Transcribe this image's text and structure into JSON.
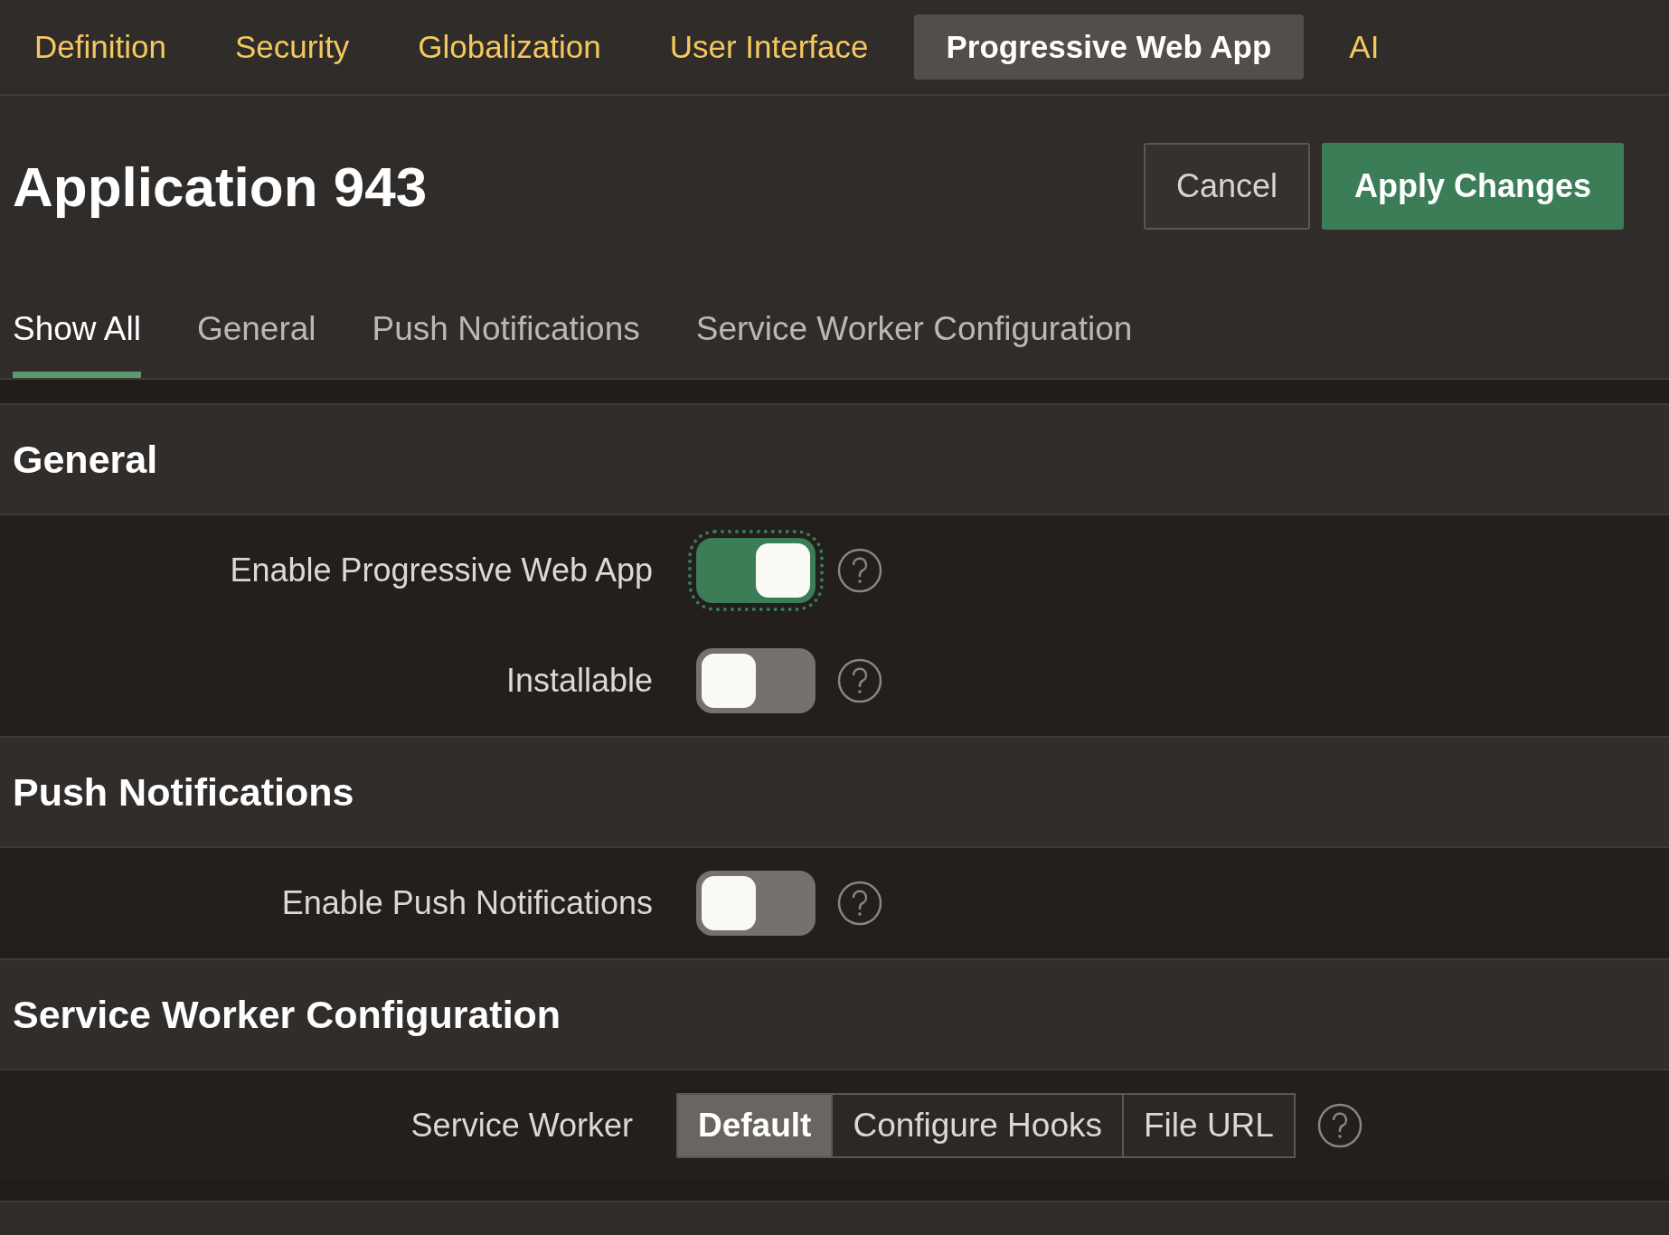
{
  "top_tabs": [
    {
      "label": "Definition",
      "selected": false
    },
    {
      "label": "Security",
      "selected": false
    },
    {
      "label": "Globalization",
      "selected": false
    },
    {
      "label": "User Interface",
      "selected": false
    },
    {
      "label": "Progressive Web App",
      "selected": true
    },
    {
      "label": "AI",
      "selected": false
    }
  ],
  "title": "Application 943",
  "buttons": [
    {
      "label": "Cancel",
      "kind": "secondary"
    },
    {
      "label": "Apply Changes",
      "kind": "primary"
    }
  ],
  "sub_tabs": [
    {
      "label": "Show All",
      "selected": true
    },
    {
      "label": "General",
      "selected": false
    },
    {
      "label": "Push Notifications",
      "selected": false
    },
    {
      "label": "Service Worker Configuration",
      "selected": false
    }
  ],
  "sections": [
    {
      "title": "General",
      "fields": [
        {
          "kind": "switch",
          "label": "Enable Progressive Web App",
          "on": true,
          "focused": true
        },
        {
          "kind": "switch",
          "label": "Installable",
          "on": false,
          "focused": false
        }
      ]
    },
    {
      "title": "Push Notifications",
      "fields": [
        {
          "kind": "switch",
          "label": "Enable Push Notifications",
          "on": false,
          "focused": false
        }
      ]
    },
    {
      "title": "Service Worker Configuration",
      "fields": [
        {
          "kind": "segmented",
          "label": "Service Worker",
          "options": [
            {
              "label": "Default",
              "selected": true
            },
            {
              "label": "Configure Hooks",
              "selected": false
            },
            {
              "label": "File URL",
              "selected": false
            }
          ]
        }
      ]
    }
  ]
}
